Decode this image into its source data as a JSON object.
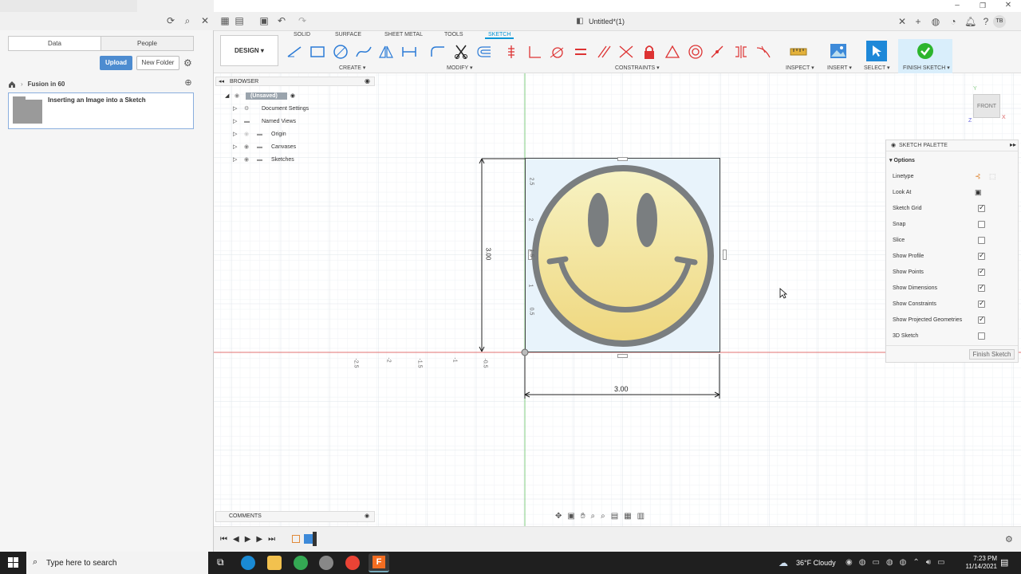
{
  "window": {
    "title": "Untitled*(1)"
  },
  "data_panel": {
    "tabs": [
      "Data",
      "People"
    ],
    "upload_label": "Upload",
    "new_folder_label": "New Folder",
    "breadcrumb": "Fusion in 60",
    "project_title": "Inserting an Image into a Sketch"
  },
  "ribbon": {
    "design_label": "DESIGN",
    "tabs": [
      "SOLID",
      "SURFACE",
      "SHEET METAL",
      "TOOLS",
      "SKETCH"
    ],
    "active_tab": "SKETCH",
    "groups": [
      "CREATE",
      "MODIFY",
      "CONSTRAINTS",
      "INSPECT",
      "INSERT",
      "SELECT",
      "FINISH SKETCH"
    ]
  },
  "browser": {
    "title": "BROWSER",
    "root": "(Unsaved)",
    "items": [
      "Document Settings",
      "Named Views",
      "Origin",
      "Canvases",
      "Sketches"
    ]
  },
  "comments_label": "COMMENTS",
  "viewcube_label": "FRONT",
  "sketch": {
    "dim_horizontal": "3.00",
    "dim_vertical": "3.00",
    "h_ticks": [
      "-2.5",
      "-2",
      "-1.5",
      "-1",
      "-0.5"
    ],
    "v_ticks": [
      "2.5",
      "2",
      "1.5",
      "1",
      "0.5"
    ]
  },
  "palette": {
    "title": "SKETCH PALETTE",
    "section": "Options",
    "rows": [
      {
        "label": "Linetype",
        "kind": "icons"
      },
      {
        "label": "Look At",
        "kind": "icon"
      },
      {
        "label": "Sketch Grid",
        "checked": true
      },
      {
        "label": "Snap",
        "checked": false
      },
      {
        "label": "Slice",
        "checked": false
      },
      {
        "label": "Show Profile",
        "checked": true
      },
      {
        "label": "Show Points",
        "checked": true
      },
      {
        "label": "Show Dimensions",
        "checked": true
      },
      {
        "label": "Show Constraints",
        "checked": true
      },
      {
        "label": "Show Projected Geometries",
        "checked": true
      },
      {
        "label": "3D Sketch",
        "checked": false
      }
    ],
    "finish_label": "Finish Sketch"
  },
  "taskbar": {
    "search_placeholder": "Type here to search",
    "weather": "36°F  Cloudy",
    "time": "7:23 PM",
    "date": "11/14/2021"
  },
  "user_initials": "TB",
  "colors": {
    "accent": "#0696d7",
    "upload": "#4d8cd0",
    "smiley_face": "#f4e9a6",
    "smiley_line": "#7a7e80",
    "green_check": "#2db52d"
  }
}
